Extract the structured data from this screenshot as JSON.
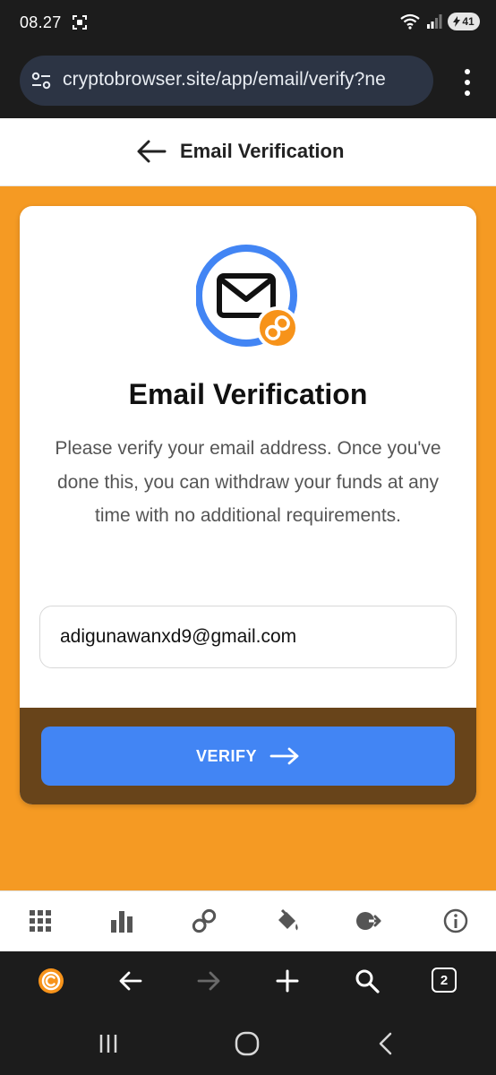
{
  "status_bar": {
    "time": "08.27",
    "battery": "41"
  },
  "browser": {
    "url": "cryptobrowser.site/app/email/verify?ne",
    "tabs_count": "2"
  },
  "header": {
    "title": "Email Verification"
  },
  "card": {
    "title": "Email Verification",
    "description": "Please verify your email address. Once you've done this, you can withdraw your funds at any time with no additional requirements.",
    "email_value": "adigunawanxd9@gmail.com",
    "verify_label": "VERIFY"
  },
  "app_nav": {
    "icons": [
      "apps-grid-icon",
      "stats-bars-icon",
      "link-icon",
      "paint-bucket-icon",
      "exit-arrow-icon",
      "info-icon"
    ]
  },
  "colors": {
    "page_bg": "#f59a23",
    "accent_blue": "#4285f4",
    "icon_orange": "#f7931a",
    "footer_brown": "#68441a",
    "dark_chrome": "#1c1c1c"
  }
}
